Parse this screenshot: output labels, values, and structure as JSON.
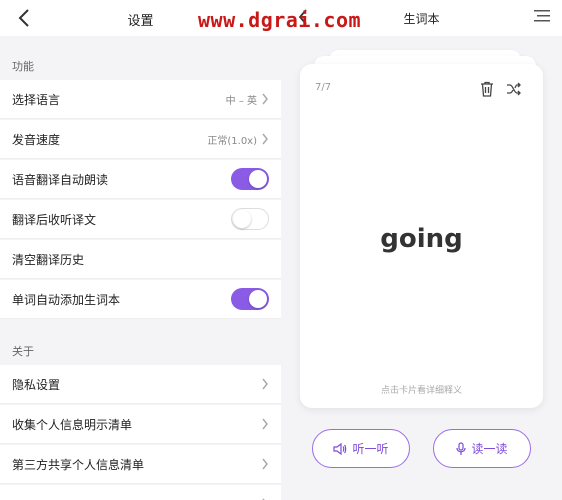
{
  "left": {
    "title": "设置",
    "sections": {
      "function_label": "功能",
      "about_label": "关于"
    },
    "rows": [
      {
        "label": "选择语言",
        "value": "中 – 英"
      },
      {
        "label": "发音速度",
        "value": "正常(1.0x)"
      },
      {
        "label": "语音翻译自动朗读",
        "toggle": true
      },
      {
        "label": "翻译后收听译文",
        "toggle": false
      },
      {
        "label": "清空翻译历史"
      },
      {
        "label": "单词自动添加生词本",
        "toggle": true
      }
    ],
    "about_rows": [
      {
        "label": "隐私设置"
      },
      {
        "label": "收集个人信息明示清单"
      },
      {
        "label": "第三方共享个人信息清单"
      }
    ]
  },
  "right": {
    "title": "生词本",
    "card": {
      "counter": "7/7",
      "word": "going",
      "hint": "点击卡片看详细释义"
    },
    "buttons": {
      "listen": "听一听",
      "read": "读一读"
    }
  },
  "watermark": "www.dgrai.com",
  "colors": {
    "accent": "#8a5ce6",
    "watermark": "#c81818"
  }
}
